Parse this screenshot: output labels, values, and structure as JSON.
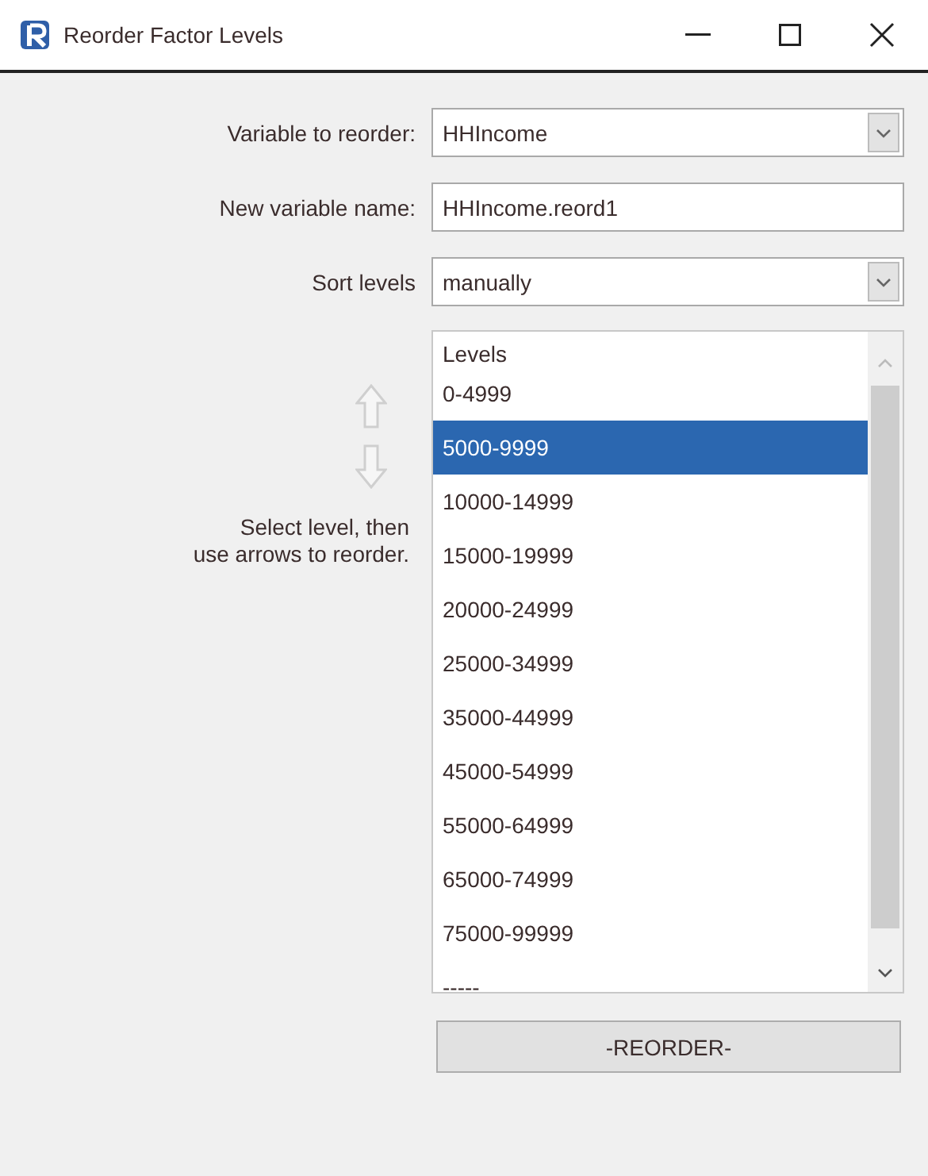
{
  "window": {
    "title": "Reorder Factor Levels"
  },
  "variable_to_reorder": {
    "label": "Variable to reorder:",
    "value": "HHIncome"
  },
  "new_variable_name": {
    "label": "New variable name:",
    "value": "HHIncome.reord1"
  },
  "sort_levels": {
    "label": "Sort levels",
    "value": "manually"
  },
  "help_text": "Select level, then\nuse arrows to reorder.",
  "levels": {
    "header": "Levels",
    "items": [
      {
        "label": "0-4999",
        "selected": false
      },
      {
        "label": "5000-9999",
        "selected": true
      },
      {
        "label": "10000-14999",
        "selected": false
      },
      {
        "label": "15000-19999",
        "selected": false
      },
      {
        "label": "20000-24999",
        "selected": false
      },
      {
        "label": "25000-34999",
        "selected": false
      },
      {
        "label": "35000-44999",
        "selected": false
      },
      {
        "label": "45000-54999",
        "selected": false
      },
      {
        "label": "55000-64999",
        "selected": false
      },
      {
        "label": "65000-74999",
        "selected": false
      },
      {
        "label": "75000-99999",
        "selected": false
      },
      {
        "label": "-----",
        "selected": false
      }
    ]
  },
  "reorder_button": "-REORDER-"
}
